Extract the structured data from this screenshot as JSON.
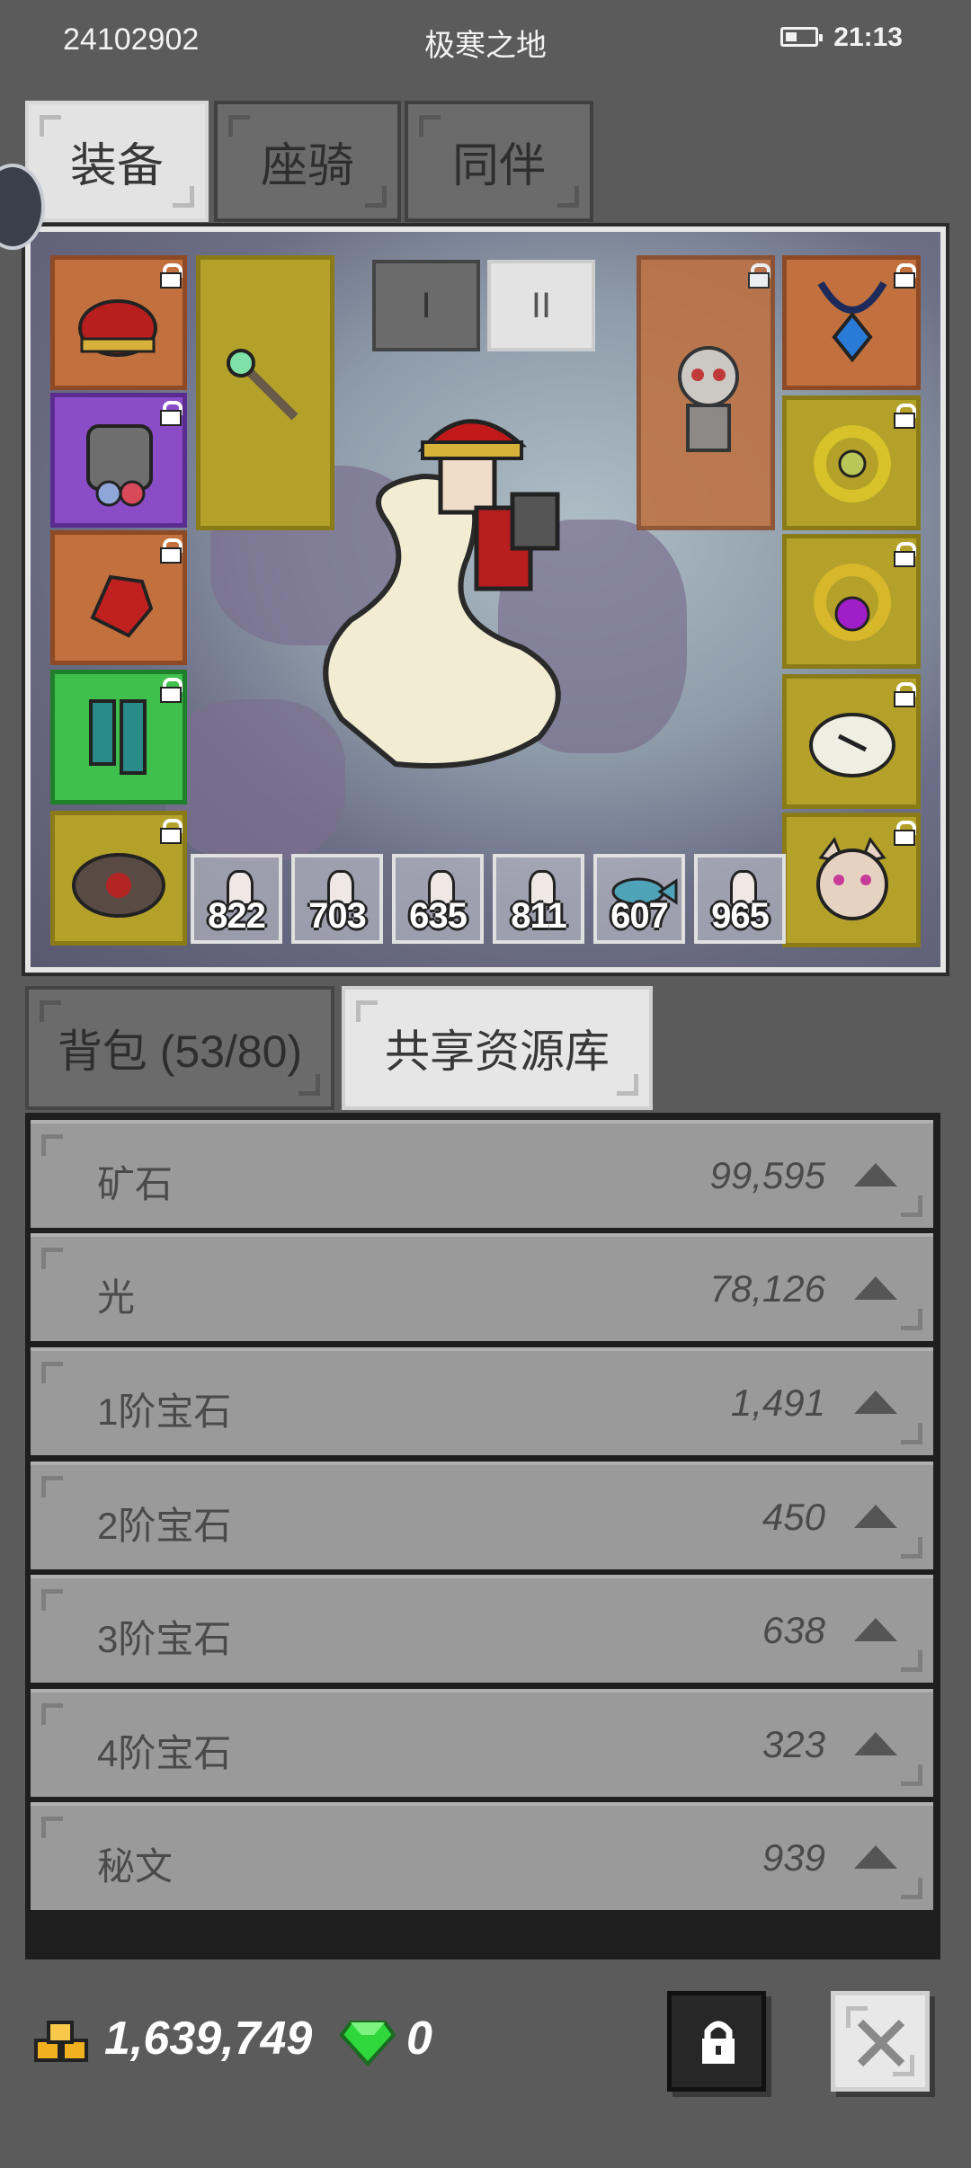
{
  "status_bar": {
    "id": "24102902",
    "location": "极寒之地",
    "time": "21:13"
  },
  "top_tabs": [
    {
      "label": "装备",
      "active": true
    },
    {
      "label": "座骑",
      "active": false
    },
    {
      "label": "同伴",
      "active": false
    }
  ],
  "page_buttons": [
    {
      "label": "I",
      "active": false
    },
    {
      "label": "II",
      "active": true
    }
  ],
  "equipment": {
    "left_slots": [
      "red-helmet-icon",
      "armor-icon",
      "glove-icon",
      "boots-icon",
      "backpack-icon"
    ],
    "weapon_slot": "wand-icon",
    "right_top_slot": "skull-companion-icon",
    "right_slots": [
      "amulet-icon",
      "ring-icon",
      "purple-ring-icon",
      "mask-icon",
      "cat-pet-icon"
    ]
  },
  "consumables": [
    {
      "icon": "potion-icon",
      "count": "822"
    },
    {
      "icon": "potion-icon",
      "count": "703"
    },
    {
      "icon": "potion-icon",
      "count": "635"
    },
    {
      "icon": "potion-icon",
      "count": "811"
    },
    {
      "icon": "fish-icon",
      "count": "607"
    },
    {
      "icon": "potion-icon",
      "count": "965"
    }
  ],
  "bag_tabs": [
    {
      "label": "背包 (53/80)",
      "active": false
    },
    {
      "label": "共享资源库",
      "active": true
    }
  ],
  "resources": [
    {
      "name": "矿石",
      "value": "99,595"
    },
    {
      "name": "光",
      "value": "78,126"
    },
    {
      "name": "1阶宝石",
      "value": "1,491"
    },
    {
      "name": "2阶宝石",
      "value": "450"
    },
    {
      "name": "3阶宝石",
      "value": "638"
    },
    {
      "name": "4阶宝石",
      "value": "323"
    },
    {
      "name": "秘文",
      "value": "939"
    }
  ],
  "footer": {
    "gold": "1,639,749",
    "gems": "0"
  },
  "colors": {
    "background": "#5b5b5b",
    "tab_active": "#e3e3e3",
    "row": "#9a9a9a"
  }
}
